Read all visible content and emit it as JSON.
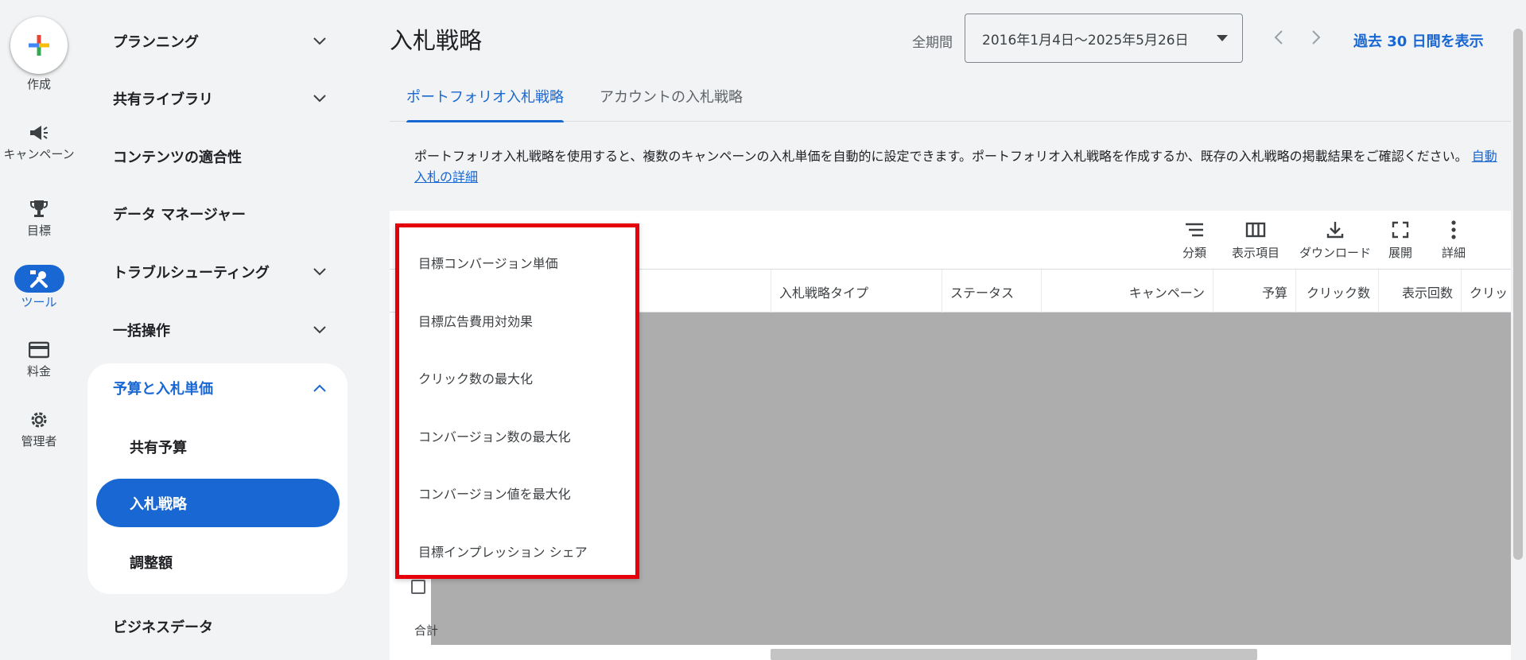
{
  "rail": {
    "create_label": "作成",
    "items": [
      {
        "label": "キャンペーン",
        "icon": "megaphone-icon"
      },
      {
        "label": "目標",
        "icon": "trophy-icon"
      },
      {
        "label": "ツール",
        "icon": "tools-icon",
        "active": true
      },
      {
        "label": "料金",
        "icon": "credit-card-icon"
      },
      {
        "label": "管理者",
        "icon": "gear-icon"
      }
    ]
  },
  "nav": {
    "items": [
      {
        "label": "プランニング",
        "expandable": true
      },
      {
        "label": "共有ライブラリ",
        "expandable": true
      },
      {
        "label": "コンテンツの適合性",
        "expandable": false
      },
      {
        "label": "データ マネージャー",
        "expandable": false
      },
      {
        "label": "トラブルシューティング",
        "expandable": true
      },
      {
        "label": "一括操作",
        "expandable": true
      },
      {
        "label": "予算と入札単価",
        "expanded": true
      },
      {
        "label": "ビジネスデータ",
        "expandable": false
      }
    ],
    "sub_items": [
      "共有予算",
      "入札戦略",
      "調整額"
    ],
    "active_sub": "入札戦略"
  },
  "header": {
    "title": "入札戦略",
    "period_label": "全期間",
    "date_range": "2016年1月4日～2025年5月26日",
    "past30": "過去 30 日間を表示"
  },
  "tabs": [
    {
      "label": "ポートフォリオ入札戦略",
      "active": true
    },
    {
      "label": "アカウントの入札戦略",
      "active": false
    }
  ],
  "description": {
    "text": "ポートフォリオ入札戦略を使用すると、複数のキャンペーンの入札単価を自動的に設定できます。ポートフォリオ入札戦略を作成するか、既存の入札戦略の掲載結果をご確認ください。",
    "link": "自動入札の詳細"
  },
  "toolbar": {
    "segment": "分類",
    "columns": "表示項目",
    "download": "ダウンロード",
    "expand": "展開",
    "more": "詳細"
  },
  "table": {
    "columns": [
      "入札戦略タイプ",
      "ステータス",
      "キャンペーン",
      "予算",
      "クリック数",
      "表示回数",
      "クリッ"
    ],
    "total_label": "合計"
  },
  "menu": {
    "items": [
      "目標コンバージョン単価",
      "目標広告費用対効果",
      "クリック数の最大化",
      "コンバージョン数の最大化",
      "コンバージョン値を最大化",
      "目標インプレッション シェア"
    ]
  },
  "colors": {
    "accent": "#1967d2",
    "highlight_border": "#e5000b",
    "mask": "#adadad"
  }
}
